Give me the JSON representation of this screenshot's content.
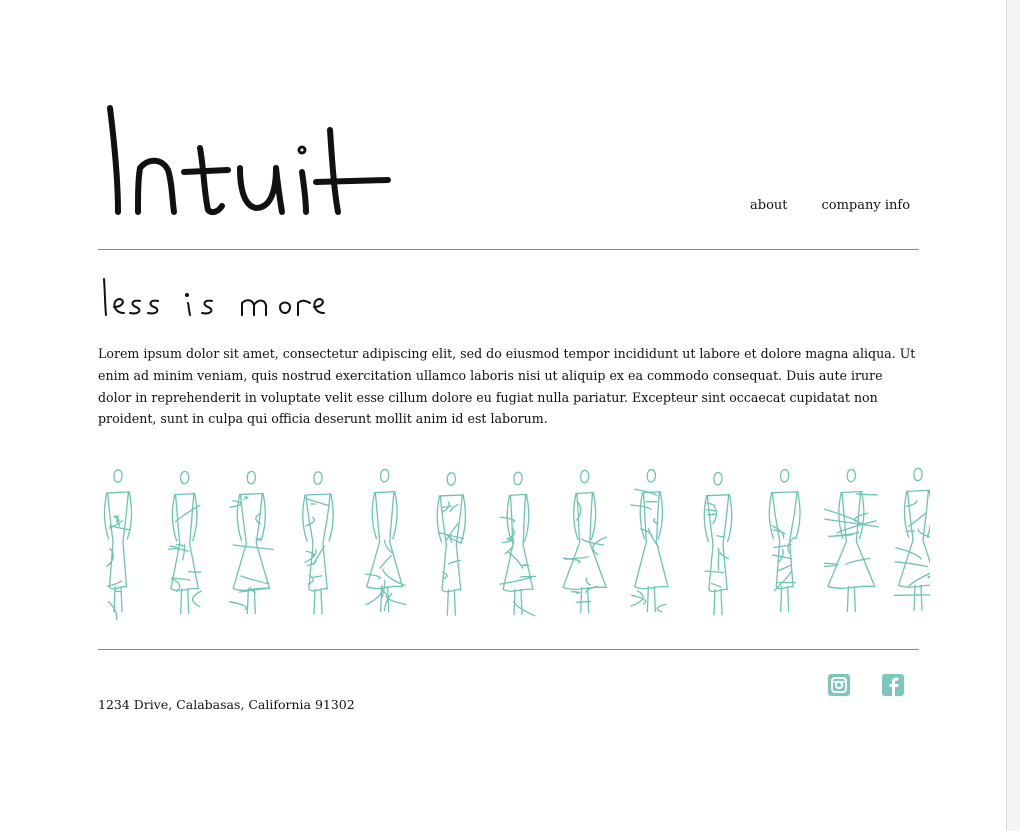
{
  "brand": {
    "logo_text": "Intuit"
  },
  "nav": {
    "items": [
      {
        "label": "about"
      },
      {
        "label": "company info"
      }
    ]
  },
  "hero": {
    "tagline": "less is more",
    "paragraph": "Lorem ipsum dolor sit amet, consectetur adipiscing elit, sed do eiusmod tempor incididunt ut labore et dolore magna aliqua. Ut enim ad minim veniam, quis nostrud exercitation ullamco laboris nisi ut aliquip ex ea commodo consequat. Duis aute irure dolor in reprehenderit in voluptate velit esse cillum dolore eu fugiat nulla pariatur. Excepteur sint occaecat cupidatat non proident, sunt in culpa qui officia deserunt mollit anim id est laborum."
  },
  "gallery": {
    "figure_count": 13,
    "accent_color": "#6cc3b6"
  },
  "footer": {
    "address": "1234 Drive, Calabasas, California 91302",
    "social": [
      {
        "icon": "instagram-icon"
      },
      {
        "icon": "facebook-icon"
      }
    ]
  },
  "colors": {
    "accent": "#7cc7bc",
    "text": "#111111",
    "rule": "#8a8a8a"
  }
}
